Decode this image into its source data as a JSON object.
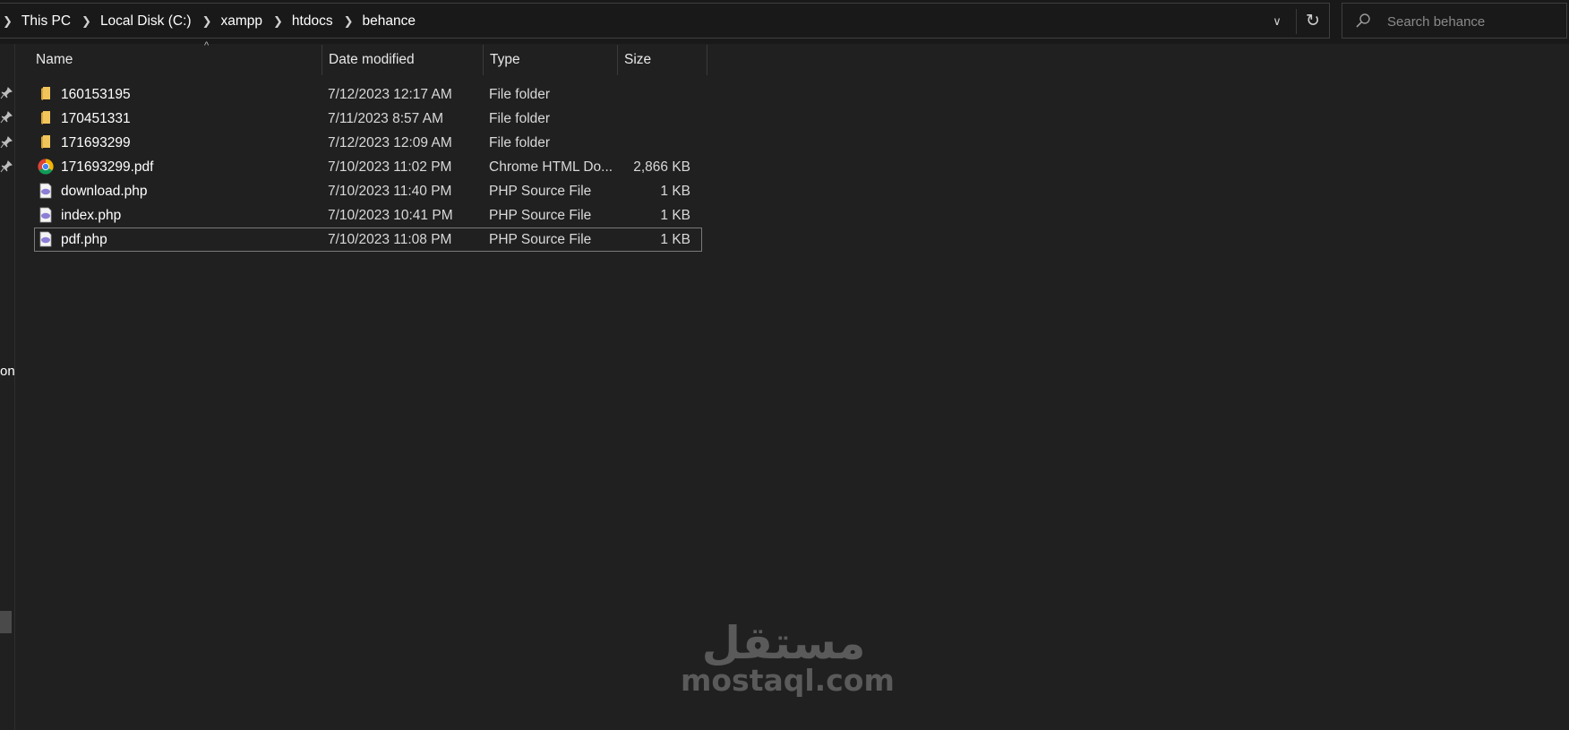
{
  "breadcrumb": {
    "items": [
      "This PC",
      "Local Disk (C:)",
      "xampp",
      "htdocs",
      "behance"
    ]
  },
  "search": {
    "placeholder": "Search behance"
  },
  "columns": {
    "name": "Name",
    "date": "Date modified",
    "type": "Type",
    "size": "Size"
  },
  "files": [
    {
      "name": "160153195",
      "date": "7/12/2023 12:17 AM",
      "type": "File folder",
      "size": "",
      "icon": "folder-icon"
    },
    {
      "name": "170451331",
      "date": "7/11/2023 8:57 AM",
      "type": "File folder",
      "size": "",
      "icon": "folder-icon"
    },
    {
      "name": "171693299",
      "date": "7/12/2023 12:09 AM",
      "type": "File folder",
      "size": "",
      "icon": "folder-icon"
    },
    {
      "name": "171693299.pdf",
      "date": "7/10/2023 11:02 PM",
      "type": "Chrome HTML Do...",
      "size": "2,866 KB",
      "icon": "chrome-icon"
    },
    {
      "name": "download.php",
      "date": "7/10/2023 11:40 PM",
      "type": "PHP Source File",
      "size": "1 KB",
      "icon": "php-file-icon"
    },
    {
      "name": "index.php",
      "date": "7/10/2023 10:41 PM",
      "type": "PHP Source File",
      "size": "1 KB",
      "icon": "php-file-icon"
    },
    {
      "name": "pdf.php",
      "date": "7/10/2023 11:08 PM",
      "type": "PHP Source File",
      "size": "1 KB",
      "icon": "php-file-icon",
      "selected": true
    }
  ],
  "nav": {
    "fragment": "on"
  },
  "watermark": {
    "arabic": "مستقل",
    "latin": "mostaql.com"
  },
  "colors": {
    "background": "#202020",
    "folder": "#f2c55c",
    "php": "#8b7fd6"
  }
}
